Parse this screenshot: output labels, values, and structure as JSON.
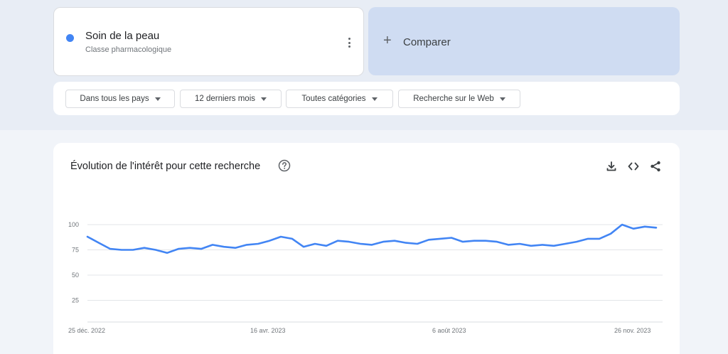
{
  "term": {
    "title": "Soin de la peau",
    "subtitle": "Classe pharmacologique",
    "color": "#4285f4",
    "menu_icon": "more-vert-icon"
  },
  "compare": {
    "plus": "+",
    "label": "Comparer"
  },
  "filters": [
    {
      "label": "Dans tous les pays"
    },
    {
      "label": "12 derniers mois"
    },
    {
      "label": "Toutes catégories"
    },
    {
      "label": "Recherche sur le Web"
    }
  ],
  "chart_panel": {
    "title": "Évolution de l'intérêt pour cette recherche",
    "help_icon": "help-circle-icon",
    "actions": [
      "download-icon",
      "embed-code-icon",
      "share-icon"
    ]
  },
  "chart_data": {
    "type": "line",
    "y_ticks": [
      "100",
      "75",
      "50",
      "25"
    ],
    "x_labels": [
      "25 déc. 2022",
      "16 avr. 2023",
      "6 août 2023",
      "26 nov. 2023"
    ],
    "ylim": [
      0,
      100
    ],
    "grid": true,
    "series": [
      {
        "color": "#4285f4",
        "values": [
          88,
          82,
          76,
          75,
          75,
          77,
          75,
          72,
          76,
          77,
          76,
          80,
          78,
          77,
          80,
          81,
          84,
          88,
          86,
          78,
          81,
          79,
          84,
          83,
          81,
          80,
          83,
          84,
          82,
          81,
          85,
          86,
          87,
          83,
          84,
          84,
          83,
          80,
          81,
          79,
          80,
          79,
          81,
          83,
          86,
          86,
          91,
          100,
          96,
          98,
          97
        ]
      }
    ]
  }
}
